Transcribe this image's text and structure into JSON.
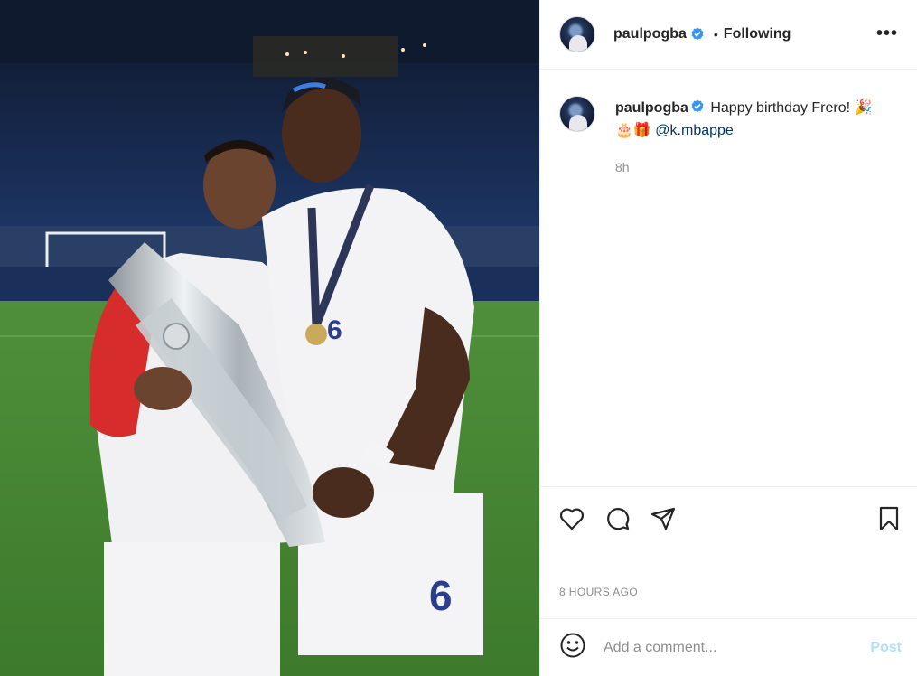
{
  "post": {
    "author": "paulpogba",
    "follow_status": "Following",
    "separator": "•",
    "more_label": "•••",
    "photo_alt": "Paul Pogba and Kylian Mbappe holding the UEFA Nations League trophy",
    "caption": {
      "username": "paulpogba",
      "text": "Happy birthday Frero! 🎉",
      "emojis": "🎂🎁",
      "mention": "@k.mbappe",
      "relative_time": "8h"
    },
    "timestamp": "8 HOURS AGO",
    "comment_placeholder": "Add a comment...",
    "post_label": "Post"
  },
  "icons": {
    "header_avatar": "avatar",
    "verified": "verified-badge-icon",
    "like": "heart-icon",
    "comment": "comment-bubble-icon",
    "share": "paper-plane-icon",
    "save": "bookmark-icon",
    "emoji": "smiley-icon"
  },
  "colors": {
    "verified": "#3897f0",
    "mention": "#00376b",
    "post_disabled": "#b2dffc",
    "muted": "#8e8e8e"
  }
}
